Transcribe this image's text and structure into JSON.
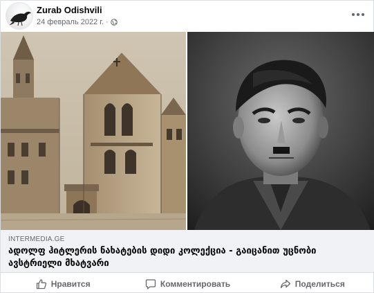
{
  "post": {
    "author": "Zurab Odishvili",
    "date": "24 февраль 2022 г.",
    "separator": "·",
    "privacy_icon": "globe-icon",
    "more_icon": "more-options-icon"
  },
  "images": {
    "left": "painting-of-old-town-hall",
    "right": "portrait-photograph"
  },
  "link_preview": {
    "domain": "INTERMEDIA.GE",
    "title": "ადოლფ ჰიტლერის ნახატების დიდი კოლექცია - გაიცანით უცნობი ავსტრიელი მხატვარი"
  },
  "actions": {
    "like_label": "Нравится",
    "like_icon": "thumbs-up-icon",
    "comment_label": "Комментировать",
    "comment_icon": "comment-bubble-icon",
    "share_label": "Поделиться",
    "share_icon": "share-arrow-icon"
  },
  "colors": {
    "text_primary": "#050505",
    "text_secondary": "#65676b",
    "link_background": "#f0f2f5",
    "border": "#dadde1"
  }
}
